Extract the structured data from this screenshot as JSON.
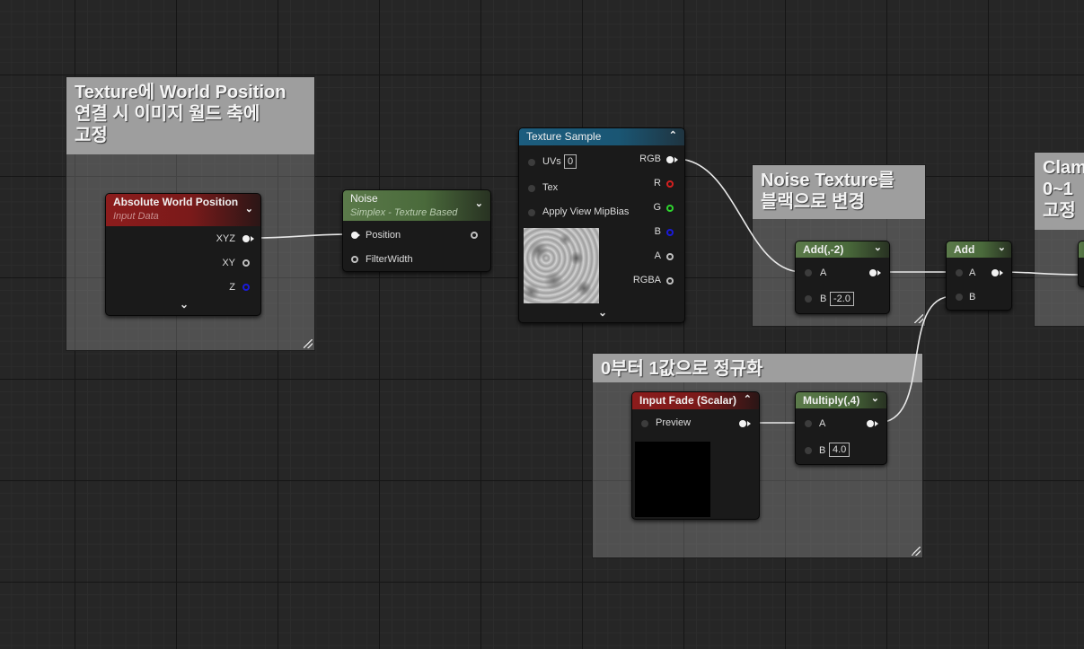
{
  "comments": {
    "world_pos": "Texture에 World Position\n연결 시 이미지 월드 축에\n고정",
    "noise_black": "Noise Texture를\n블랙으로 변경",
    "normalize": "0부터 1값으로 정규화",
    "clamp": "Clam\n0~1\n고정"
  },
  "nodes": {
    "abs_world": {
      "title": "Absolute World Position",
      "subtitle": "Input Data",
      "pins": [
        "XYZ",
        "XY",
        "Z"
      ]
    },
    "noise": {
      "title": "Noise",
      "subtitle": "Simplex - Texture Based",
      "pins": [
        "Position",
        "FilterWidth"
      ]
    },
    "texture_sample": {
      "title": "Texture Sample",
      "inputs": [
        "UVs",
        "Tex",
        "Apply View MipBias"
      ],
      "uvs_value": "0",
      "outputs": [
        "RGB",
        "R",
        "G",
        "B",
        "A",
        "RGBA"
      ]
    },
    "add_neg2": {
      "title": "Add(,-2)",
      "pins": [
        "A",
        "B"
      ],
      "b_value": "-2.0"
    },
    "add": {
      "title": "Add",
      "pins": [
        "A",
        "B"
      ]
    },
    "input_fade": {
      "title": "Input Fade (Scalar)",
      "pin": "Preview"
    },
    "multiply": {
      "title": "Multiply(,4)",
      "pins": [
        "A",
        "B"
      ],
      "b_value": "4.0"
    }
  },
  "colors": {
    "grid_bg": "#262626",
    "header_red": "#8c1c1c",
    "header_green": "#5b7a4a",
    "header_blue": "#1c5d7e",
    "comment_title": "#9e9e9e",
    "wire": "#e8e8e8"
  }
}
